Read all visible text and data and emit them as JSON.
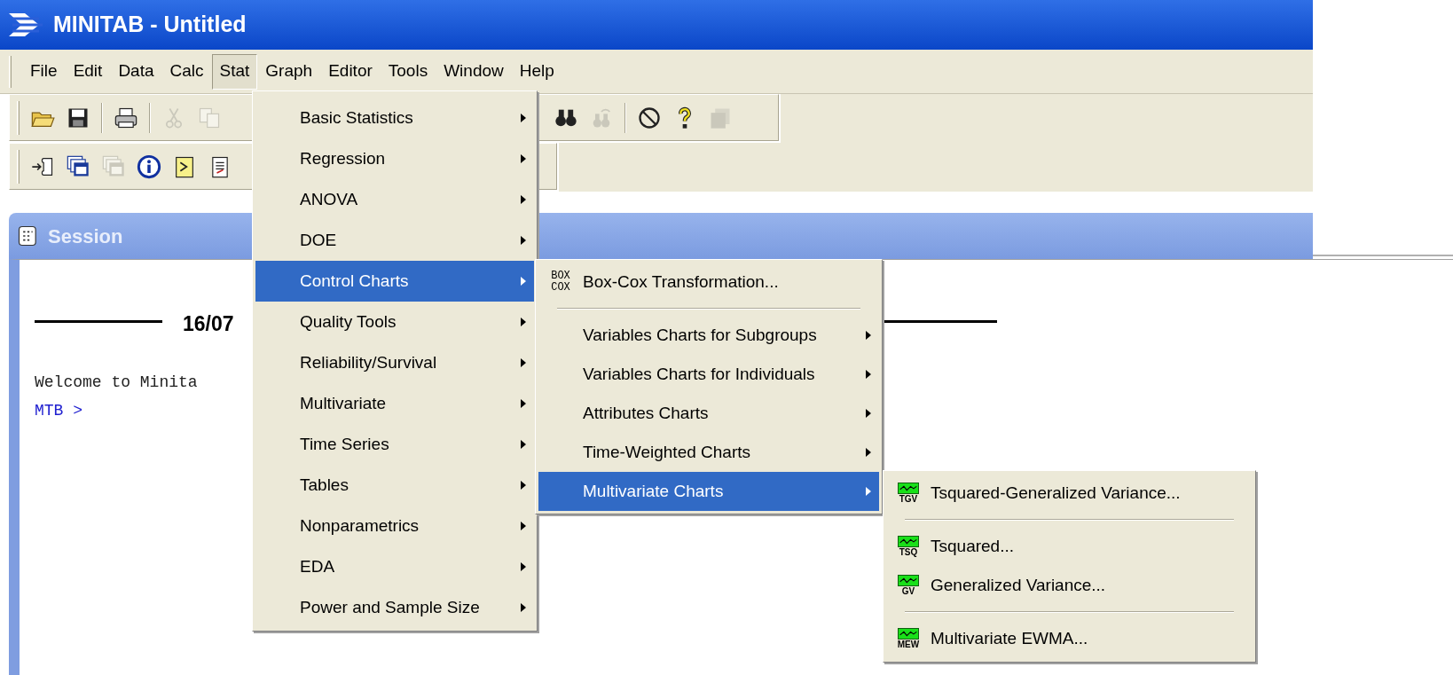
{
  "window": {
    "title": "MINITAB - Untitled"
  },
  "menu_bar": [
    {
      "label": "File",
      "selected": false
    },
    {
      "label": "Edit",
      "selected": false
    },
    {
      "label": "Data",
      "selected": false
    },
    {
      "label": "Calc",
      "selected": false
    },
    {
      "label": "Stat",
      "selected": true
    },
    {
      "label": "Graph",
      "selected": false
    },
    {
      "label": "Editor",
      "selected": false
    },
    {
      "label": "Tools",
      "selected": false
    },
    {
      "label": "Window",
      "selected": false
    },
    {
      "label": "Help",
      "selected": false
    }
  ],
  "toolbars": [
    {
      "groups": [
        [
          {
            "kind": "open",
            "disabled": false
          },
          {
            "kind": "save",
            "disabled": false
          },
          {
            "kind": "divider"
          },
          {
            "kind": "print",
            "disabled": false
          },
          {
            "kind": "divider"
          },
          {
            "kind": "cut",
            "disabled": true
          },
          {
            "kind": "copy",
            "disabled": true
          }
        ],
        [
          {
            "kind": "find",
            "disabled": false
          },
          {
            "kind": "replace",
            "disabled": true
          },
          {
            "kind": "divider"
          },
          {
            "kind": "cancel",
            "disabled": false
          },
          {
            "kind": "help",
            "disabled": false
          },
          {
            "kind": "stack",
            "disabled": true
          }
        ]
      ]
    },
    {
      "groups": [
        [
          {
            "kind": "scroll",
            "disabled": false
          },
          {
            "kind": "windows",
            "disabled": false
          },
          {
            "kind": "windows",
            "disabled": true
          },
          {
            "kind": "info",
            "disabled": false
          },
          {
            "kind": "notebook",
            "disabled": false
          },
          {
            "kind": "document",
            "disabled": false
          }
        ]
      ]
    }
  ],
  "session": {
    "title": "Session",
    "date": "16/07",
    "welcome": "Welcome to Minita",
    "prompt": "MTB >"
  },
  "stat_menu": {
    "items": [
      {
        "kind": "submenu",
        "label": "Basic Statistics",
        "selected": false
      },
      {
        "kind": "submenu",
        "label": "Regression",
        "selected": false
      },
      {
        "kind": "submenu",
        "label": "ANOVA",
        "selected": false
      },
      {
        "kind": "submenu",
        "label": "DOE",
        "selected": false
      },
      {
        "kind": "submenu",
        "label": "Control Charts",
        "selected": true
      },
      {
        "kind": "submenu",
        "label": "Quality Tools",
        "selected": false
      },
      {
        "kind": "submenu",
        "label": "Reliability/Survival",
        "selected": false
      },
      {
        "kind": "submenu",
        "label": "Multivariate",
        "selected": false
      },
      {
        "kind": "submenu",
        "label": "Time Series",
        "selected": false
      },
      {
        "kind": "submenu",
        "label": "Tables",
        "selected": false
      },
      {
        "kind": "submenu",
        "label": "Nonparametrics",
        "selected": false
      },
      {
        "kind": "submenu",
        "label": "EDA",
        "selected": false
      },
      {
        "kind": "submenu",
        "label": "Power and Sample Size",
        "selected": false
      }
    ]
  },
  "control_charts_menu": {
    "items": [
      {
        "kind": "command",
        "label": "Box-Cox Transformation...",
        "icon_text": [
          "BOX",
          "COX"
        ],
        "selected": false
      },
      {
        "kind": "separator"
      },
      {
        "kind": "submenu",
        "label": "Variables Charts for Subgroups",
        "selected": false
      },
      {
        "kind": "submenu",
        "label": "Variables Charts for Individuals",
        "selected": false
      },
      {
        "kind": "submenu",
        "label": "Attributes Charts",
        "selected": false
      },
      {
        "kind": "submenu",
        "label": "Time-Weighted Charts",
        "selected": false
      },
      {
        "kind": "submenu",
        "label": "Multivariate Charts",
        "selected": true
      }
    ]
  },
  "multivariate_charts_menu": {
    "items": [
      {
        "kind": "chart_command",
        "label": "Tsquared-Generalized Variance...",
        "icon_text": [
          "TGV"
        ],
        "selected": false
      },
      {
        "kind": "separator"
      },
      {
        "kind": "chart_command",
        "label": "Tsquared...",
        "icon_text": [
          "TSQ"
        ],
        "selected": false
      },
      {
        "kind": "chart_command",
        "label": "Generalized Variance...",
        "icon_text": [
          "GV"
        ],
        "selected": false
      },
      {
        "kind": "separator"
      },
      {
        "kind": "chart_command",
        "label": "Multivariate EWMA...",
        "icon_text": [
          "MEW"
        ],
        "selected": false
      }
    ]
  }
}
